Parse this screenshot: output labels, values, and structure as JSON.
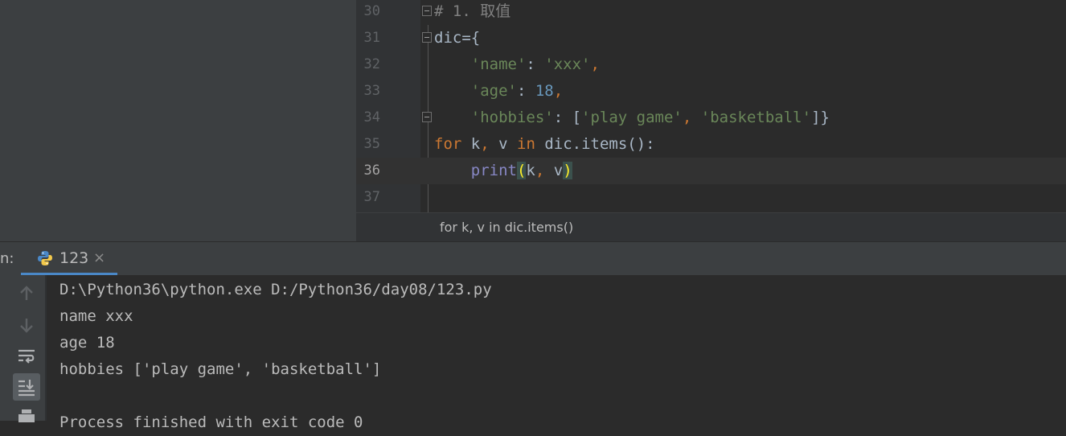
{
  "editor": {
    "lines": [
      {
        "n": "30",
        "segments": [
          {
            "t": "# 1. 取值",
            "c": "cmt"
          }
        ]
      },
      {
        "n": "31",
        "segments": [
          {
            "t": "dic={",
            "c": ""
          }
        ]
      },
      {
        "n": "32",
        "segments": [
          {
            "t": "    ",
            "c": ""
          },
          {
            "t": "'name'",
            "c": "str"
          },
          {
            "t": ": ",
            "c": ""
          },
          {
            "t": "'xxx'",
            "c": "str"
          },
          {
            "t": ",",
            "c": "kw"
          }
        ]
      },
      {
        "n": "33",
        "segments": [
          {
            "t": "    ",
            "c": ""
          },
          {
            "t": "'age'",
            "c": "str"
          },
          {
            "t": ": ",
            "c": ""
          },
          {
            "t": "18",
            "c": "num"
          },
          {
            "t": ",",
            "c": "kw"
          }
        ]
      },
      {
        "n": "34",
        "segments": [
          {
            "t": "    ",
            "c": ""
          },
          {
            "t": "'hobbies'",
            "c": "str"
          },
          {
            "t": ": [",
            "c": ""
          },
          {
            "t": "'play game'",
            "c": "str"
          },
          {
            "t": ", ",
            "c": "kw"
          },
          {
            "t": "'basketball'",
            "c": "str"
          },
          {
            "t": "]}",
            "c": ""
          }
        ]
      },
      {
        "n": "35",
        "segments": [
          {
            "t": "for",
            "c": "kw"
          },
          {
            "t": " k",
            "c": ""
          },
          {
            "t": ",",
            "c": "kw"
          },
          {
            "t": " v ",
            "c": ""
          },
          {
            "t": "in",
            "c": "kw"
          },
          {
            "t": " dic.items():",
            "c": ""
          }
        ]
      },
      {
        "n": "36",
        "segments": [
          {
            "t": "    ",
            "c": ""
          },
          {
            "t": "print",
            "c": "builtin"
          },
          {
            "t": "(",
            "c": "bm"
          },
          {
            "t": "k",
            "c": ""
          },
          {
            "t": ",",
            "c": "kw"
          },
          {
            "t": " v",
            "c": ""
          },
          {
            "t": ")",
            "c": "bm"
          }
        ]
      },
      {
        "n": "37",
        "segments": []
      }
    ],
    "current_line": "36",
    "breadcrumb": "for k, v in dic.items()"
  },
  "run": {
    "label": "n:",
    "tab_label": "123",
    "tab_close": "×"
  },
  "console": {
    "lines": [
      "D:\\Python36\\python.exe D:/Python36/day08/123.py",
      "name xxx",
      "age 18",
      "hobbies ['play game', 'basketball']",
      "",
      "Process finished with exit code 0"
    ]
  },
  "tools": [
    "arrow-up-icon",
    "arrow-down-icon",
    "soft-wrap-icon",
    "scroll-to-end-icon",
    "print-icon"
  ]
}
